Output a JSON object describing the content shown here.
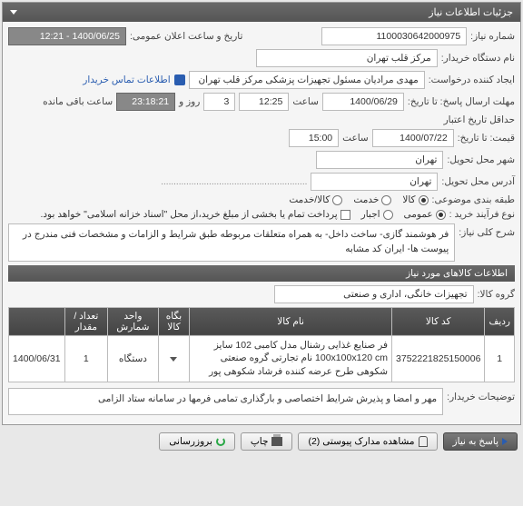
{
  "header": {
    "title": "جزئیات اطلاعات نیاز"
  },
  "fields": {
    "request_no_label": "شماره نیاز:",
    "request_no": "1100030642000975",
    "public_date_label": "تاریخ و ساعت اعلان عمومی:",
    "public_date": "1400/06/25 - 12:21",
    "buyer_label": "نام دستگاه خریدار:",
    "buyer": "مرکز قلب تهران",
    "requester_label": "ایجاد کننده درخواست:",
    "requester": "مهدی مرادیان مسئول تجهیزات پزشکی مرکز قلب تهران",
    "contact_link": "اطلاعات تماس خریدار",
    "deadline_label": "مهلت ارسال پاسخ: تا تاریخ:",
    "deadline_date": "1400/06/29",
    "deadline_time_label": "ساعت",
    "deadline_time": "12:25",
    "days_remaining": "3",
    "days_and": "روز و",
    "time_remaining": "23:18:21",
    "time_remaining_suffix": "ساعت باقی مانده",
    "min_label": "حداقل تاریخ اعتبار",
    "price_label": "قیمت: تا تاریخ:",
    "price_date": "1400/07/22",
    "price_time_label": "ساعت",
    "price_time": "15:00",
    "city_label": "شهر محل تحویل:",
    "city": "تهران",
    "address_label": "آدرس محل تحویل:",
    "address": "تهران",
    "category_label": "طبقه بندی موضوعی:",
    "cat_goods": "کالا",
    "cat_service": "خدمت",
    "cat_both": "کالا/خدمت",
    "process_label": "نوع فرآیند خرید :",
    "proc_main": "عمومی",
    "proc_force": "اجبار",
    "proc_payment": "پرداخت تمام یا بخشی از مبلغ خرید،از محل \"اسناد خزانه اسلامی\" خواهد بود.",
    "desc_label": "شرح کلی نیاز:",
    "desc": "فر هوشمند گازی- ساخت داخل- به همراه متعلقات مربوطه  طبق شرایط و الزامات و مشخصات فنی مندرج در پیوست ها- ایران کد مشابه",
    "goods_section": "اطلاعات کالاهای مورد نیاز",
    "group_label": "گروه کالا:",
    "group": "تجهیزات خانگی، اداری و صنعتی"
  },
  "table": {
    "headers": {
      "row": "ردیف",
      "code": "کد کالا",
      "name": "نام کالا",
      "pkg": "بگاه کالا",
      "unit": "واحد شمارش",
      "qty": "تعداد / مقدار",
      "date": ""
    },
    "rows": [
      {
        "idx": "1",
        "code": "3752221825150006",
        "name": "فر صنایع غذایی رشنال مدل کامبی 102 سایز 100x100x120 cm نام تجارتی گروه صنعتی شکوهی طرح عرضه کننده فرشاد شکوهی پور",
        "unit": "دستگاه",
        "qty": "1",
        "date": "1400/06/31"
      }
    ]
  },
  "notes": {
    "label": "توضیحات خریدار:",
    "text": "مهر و امضا و پذیرش شرایط اختصاصی و بارگذاری تمامی فرمها در سامانه ستاد الزامی"
  },
  "footer": {
    "reply": "پاسخ به نیاز",
    "attachments": "مشاهده مدارک پیوستی (2)",
    "print": "چاپ",
    "refresh": "بروزرسانی"
  }
}
